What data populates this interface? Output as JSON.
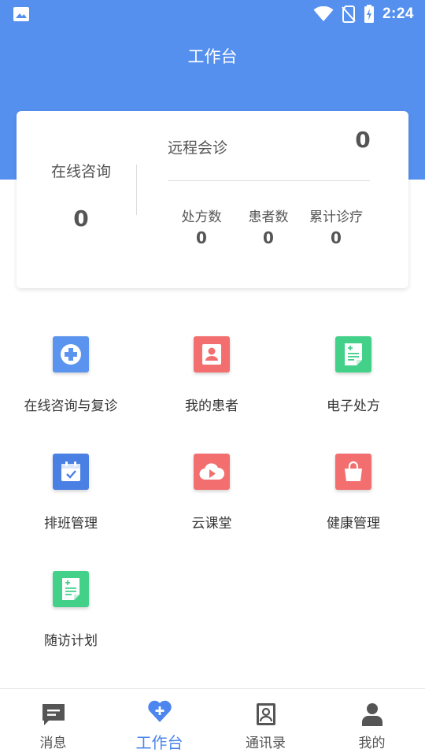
{
  "status_bar": {
    "time": "2:24"
  },
  "header": {
    "title": "工作台"
  },
  "stats": {
    "online": {
      "label": "在线咨询",
      "value": "0"
    },
    "remote": {
      "label": "远程会诊",
      "value": "0"
    },
    "items": [
      {
        "label": "处方数",
        "value": "0"
      },
      {
        "label": "患者数",
        "value": "0"
      },
      {
        "label": "累计诊疗",
        "value": "0"
      }
    ]
  },
  "grid": [
    {
      "label": "在线咨询与复诊",
      "icon": "medical-cross-icon",
      "color": "#5b94ee"
    },
    {
      "label": "我的患者",
      "icon": "patient-card-icon",
      "color": "#f36f6f"
    },
    {
      "label": "电子处方",
      "icon": "prescription-icon",
      "color": "#43d18a"
    },
    {
      "label": "排班管理",
      "icon": "calendar-icon",
      "color": "#4a7fe3"
    },
    {
      "label": "云课堂",
      "icon": "cloud-play-icon",
      "color": "#f36f6f"
    },
    {
      "label": "健康管理",
      "icon": "shopping-bag-icon",
      "color": "#f36f6f"
    },
    {
      "label": "随访计划",
      "icon": "followup-doc-icon",
      "color": "#43d18a"
    }
  ],
  "bottom_nav": [
    {
      "label": "消息",
      "icon": "message-icon",
      "active": false
    },
    {
      "label": "工作台",
      "icon": "heart-plus-icon",
      "active": true
    },
    {
      "label": "通讯录",
      "icon": "contacts-icon",
      "active": false
    },
    {
      "label": "我的",
      "icon": "person-icon",
      "active": false
    }
  ],
  "colors": {
    "primary": "#5590ef",
    "active_tab": "#4d86ee"
  }
}
